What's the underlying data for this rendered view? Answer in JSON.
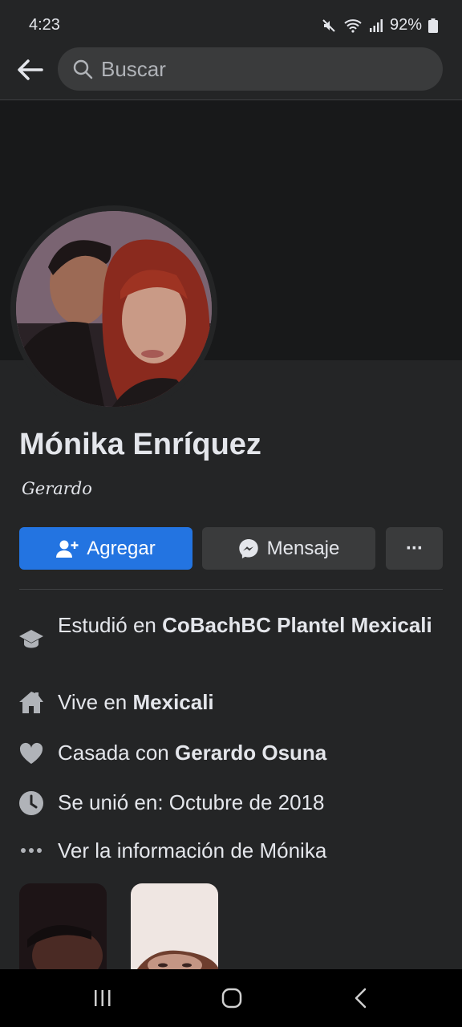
{
  "status_bar": {
    "time": "4:23",
    "battery": "92%"
  },
  "search": {
    "placeholder": "Buscar"
  },
  "profile": {
    "name": "Mónika Enríquez",
    "bio": "Gerardo"
  },
  "actions": {
    "add_label": "Agregar",
    "message_label": "Mensaje",
    "more_label": "···"
  },
  "info": {
    "studied_prefix": "Estudió en ",
    "studied_place": "CoBachBC Plantel Mexicali",
    "lives_prefix": "Vive en ",
    "lives_place": "Mexicali",
    "married_prefix": "Casada con ",
    "married_to": "Gerardo Osuna",
    "joined": "Se unió en: Octubre de 2018",
    "see_info": "Ver la información de Mónika"
  },
  "colors": {
    "accent": "#2374e1",
    "background": "#242526",
    "cover": "#18191a"
  }
}
